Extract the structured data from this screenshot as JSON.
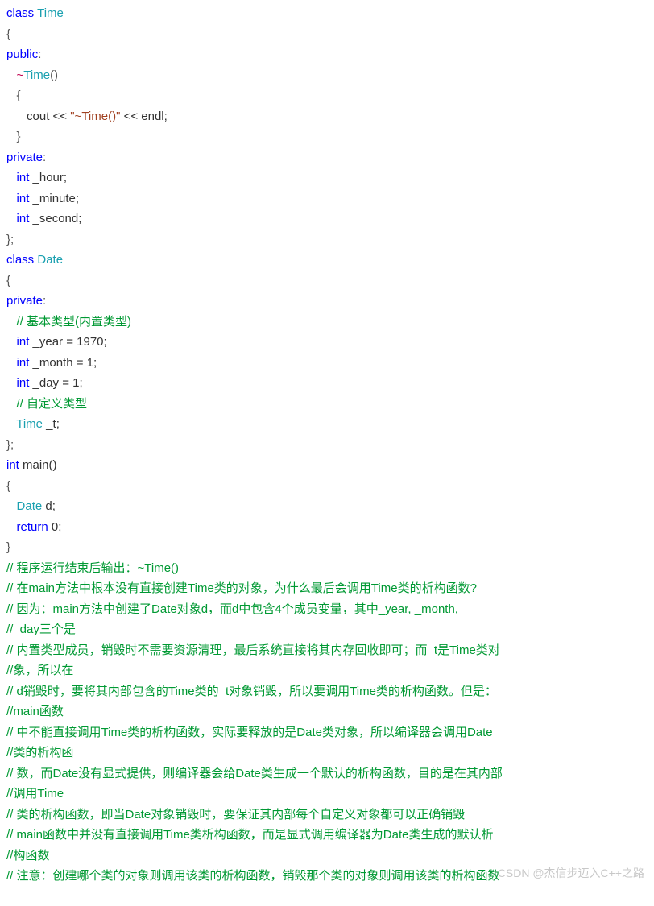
{
  "code": {
    "l1_kw_class": "class",
    "l1_type": "Time",
    "l2_brace": "{",
    "l3_public": "public",
    "l3_colon": ":",
    "l4_dtor_op": "~",
    "l4_dtor_name": "Time",
    "l4_dtor_paren": "()",
    "l5_brace": "{",
    "l6_cout": "cout << ",
    "l6_str": "\"~Time()\"",
    "l6_rest": " << endl;",
    "l7_brace": "}",
    "l8_private": "private",
    "l8_colon": ":",
    "l9_int": "int",
    "l9_id": " _hour;",
    "l10_int": "int",
    "l10_id": " _minute;",
    "l11_int": "int",
    "l11_id": " _second;",
    "l12_end": "};",
    "l13_kw_class": "class",
    "l13_type": "Date",
    "l14_brace": "{",
    "l15_private": "private",
    "l15_colon": ":",
    "l16_cmt": "// 基本类型(内置类型)",
    "l17_int": "int",
    "l17_rest": " _year = 1970;",
    "l18_int": "int",
    "l18_rest": " _month = 1;",
    "l19_int": "int",
    "l19_rest": " _day = 1;",
    "l20_cmt": "// 自定义类型",
    "l21_type": "Time",
    "l21_rest": " _t;",
    "l22_end": "};",
    "l23_int": "int",
    "l23_main": " main()",
    "l24_brace": "{",
    "l25_type": "Date",
    "l25_rest": " d;",
    "l26_return": "return",
    "l26_rest": " 0;",
    "l27_brace": "}"
  },
  "comments": {
    "c1": "// 程序运行结束后输出：~Time()",
    "c2": "// 在main方法中根本没有直接创建Time类的对象，为什么最后会调用Time类的析构函数?",
    "c3": "// 因为：main方法中创建了Date对象d，而d中包含4个成员变量，其中_year, _month,",
    "c4": "//_day三个是",
    "c5": "// 内置类型成员，销毁时不需要资源清理，最后系统直接将其内存回收即可；而_t是Time类对",
    "c6": "//象，所以在",
    "c7": "// d销毁时，要将其内部包含的Time类的_t对象销毁，所以要调用Time类的析构函数。但是：",
    "c8": "//main函数",
    "c9": "// 中不能直接调用Time类的析构函数，实际要释放的是Date类对象，所以编译器会调用Date",
    "c10": "//类的析构函",
    "c11": "// 数，而Date没有显式提供，则编译器会给Date类生成一个默认的析构函数，目的是在其内部",
    "c12": "//调用Time",
    "c13": "// 类的析构函数，即当Date对象销毁时，要保证其内部每个自定义对象都可以正确销毁",
    "c14": "// main函数中并没有直接调用Time类析构函数，而是显式调用编译器为Date类生成的默认析",
    "c15": "//构函数",
    "c16": "// 注意：创建哪个类的对象则调用该类的析构函数，销毁那个类的对象则调用该类的析构函数"
  },
  "watermark": "CSDN @杰信步迈入C++之路"
}
